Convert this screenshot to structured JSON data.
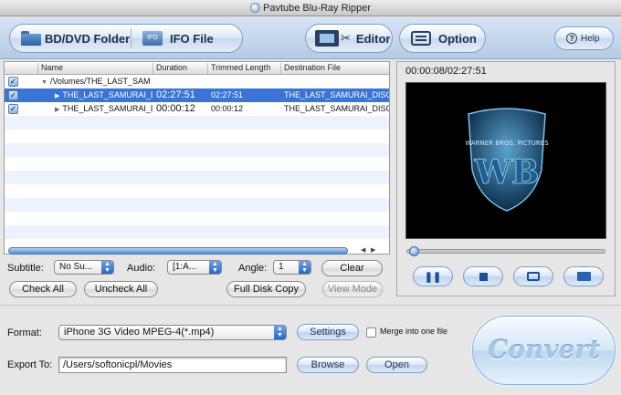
{
  "window": {
    "title": "Pavtube Blu-Ray Ripper"
  },
  "toolbar": {
    "bd_dvd_folder": "BD/DVD Folder",
    "ifo_file": "IFO File",
    "ifo_icon_text": "IFO",
    "editor": "Editor",
    "option": "Option",
    "help": "Help"
  },
  "list": {
    "columns": [
      "Name",
      "Duration",
      "Trimmed Length",
      "Destination File"
    ],
    "rows": [
      {
        "checked": true,
        "name": "/Volumes/THE_LAST_SAM",
        "duration": "",
        "trimmed": "",
        "dest": "",
        "level": 0,
        "selected": false
      },
      {
        "checked": true,
        "name": "THE_LAST_SAMURAI_DI",
        "duration": "02:27:51",
        "trimmed": "02:27:51",
        "dest": "THE_LAST_SAMURAI_DISC",
        "level": 1,
        "selected": true
      },
      {
        "checked": true,
        "name": "THE_LAST_SAMURAI_DI",
        "duration": "00:00:12",
        "trimmed": "00:00:12",
        "dest": "THE_LAST_SAMURAI_DISC",
        "level": 1,
        "selected": false
      }
    ]
  },
  "controls": {
    "subtitle_label": "Subtitle:",
    "subtitle_value": "No Su...",
    "audio_label": "Audio:",
    "audio_value": "[1:A...",
    "angle_label": "Angle:",
    "angle_value": "1",
    "clear": "Clear",
    "check_all": "Check All",
    "uncheck_all": "Uncheck All",
    "full_disk_copy": "Full Disk Copy",
    "view_mode": "View Mode"
  },
  "preview": {
    "time": "00:00:08/02:27:51",
    "logo_text": "WARNER BROS. PICTURES",
    "logo_letters": "WB"
  },
  "output": {
    "format_label": "Format:",
    "format_value": "iPhone 3G Video MPEG-4(*.mp4)",
    "settings": "Settings",
    "merge_label": "Merge into one file",
    "merge_checked": false,
    "export_label": "Export To:",
    "export_value": "/Users/softonicpl/Movies",
    "browse": "Browse",
    "open": "Open",
    "convert": "Convert"
  }
}
